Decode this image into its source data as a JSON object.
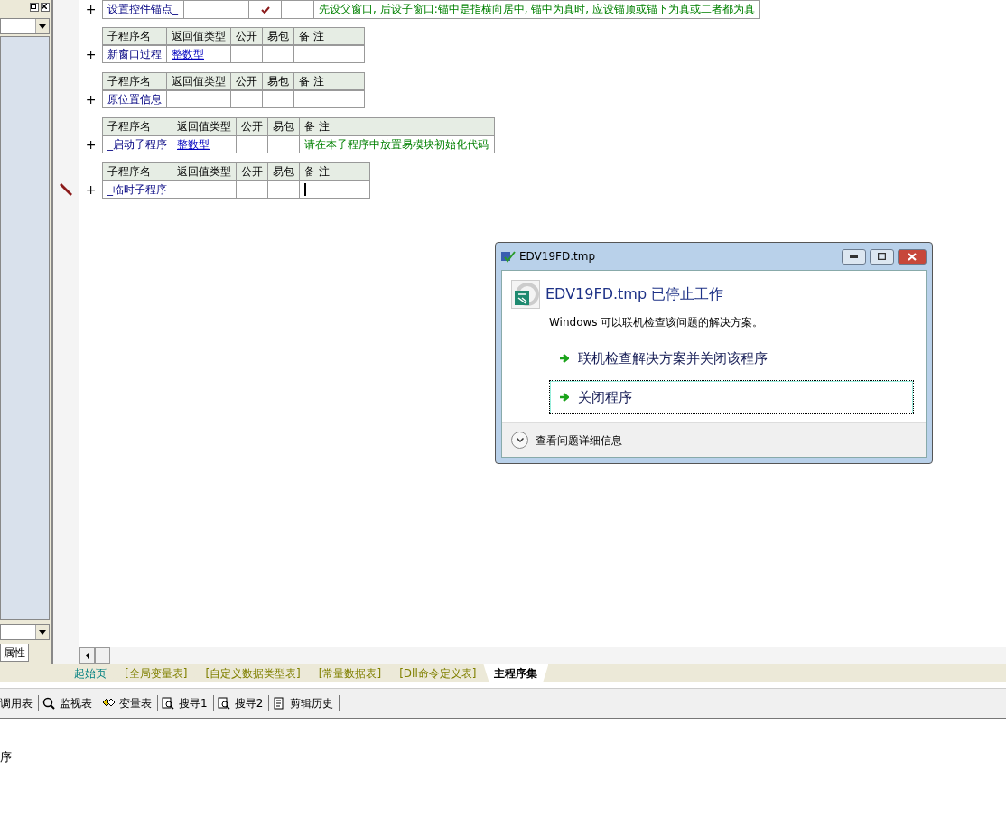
{
  "left_panel": {
    "panel_tab": "属性"
  },
  "subroutine_tables": [
    {
      "rows": [
        {
          "name": "设置控件锚点_",
          "return_type": "",
          "public": true,
          "easy_pack": false,
          "note": "先设父窗口, 后设子窗口:锚中是指横向居中, 锚中为真时, 应设锚顶或锚下为真或二者都为真",
          "current": false
        }
      ]
    },
    {
      "columns": [
        "子程序名",
        "返回值类型",
        "公开",
        "易包",
        "备 注"
      ],
      "rows": [
        {
          "name": "新窗口过程",
          "return_type": "整数型",
          "public": false,
          "easy_pack": false,
          "note": "",
          "current": false
        }
      ]
    },
    {
      "columns": [
        "子程序名",
        "返回值类型",
        "公开",
        "易包",
        "备 注"
      ],
      "rows": [
        {
          "name": "原位置信息",
          "return_type": "",
          "public": false,
          "easy_pack": false,
          "note": "",
          "current": false
        }
      ]
    },
    {
      "columns": [
        "子程序名",
        "返回值类型",
        "公开",
        "易包",
        "备 注"
      ],
      "rows": [
        {
          "name": "_启动子程序",
          "return_type": "整数型",
          "public": false,
          "easy_pack": false,
          "note": "请在本子程序中放置易模块初始化代码",
          "current": false
        }
      ]
    },
    {
      "columns": [
        "子程序名",
        "返回值类型",
        "公开",
        "易包",
        "备 注"
      ],
      "rows": [
        {
          "name": "_临时子程序",
          "return_type": "",
          "public": false,
          "easy_pack": false,
          "note": "",
          "current": true
        }
      ]
    }
  ],
  "expand_mark": "+",
  "editor_tabs": [
    {
      "label": "起始页",
      "kind": "start",
      "selected": false
    },
    {
      "label": "[全局变量表]",
      "kind": "table",
      "selected": false
    },
    {
      "label": "[自定义数据类型表]",
      "kind": "table",
      "selected": false
    },
    {
      "label": "[常量数据表]",
      "kind": "table",
      "selected": false
    },
    {
      "label": "[Dll命令定义表]",
      "kind": "table",
      "selected": false
    },
    {
      "label": "主程序集",
      "kind": "module",
      "selected": true
    }
  ],
  "bottom_toolbar": [
    {
      "label": "调用表",
      "kind": "plain"
    },
    {
      "label": "监视表",
      "kind": "watch"
    },
    {
      "label": "变量表",
      "kind": "variables"
    },
    {
      "label": "搜寻1",
      "kind": "search"
    },
    {
      "label": "搜寻2",
      "kind": "search"
    },
    {
      "label": "剪辑历史",
      "kind": "history"
    }
  ],
  "output_text": "序",
  "dialog": {
    "title": "EDV19FD.tmp",
    "heading": "EDV19FD.tmp 已停止工作",
    "message": "Windows 可以联机检查该问题的解决方案。",
    "options": [
      {
        "label": "联机检查解决方案并关闭该程序",
        "focused": false
      },
      {
        "label": "关闭程序",
        "focused": true
      }
    ],
    "details_label": "查看问题详细信息"
  }
}
